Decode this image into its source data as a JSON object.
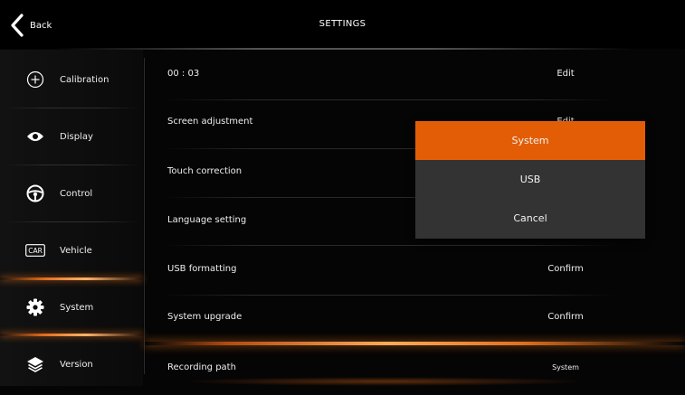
{
  "header": {
    "back_label": "Back",
    "title": "SETTINGS"
  },
  "sidebar": {
    "active_index": 4,
    "items": [
      {
        "label": "Calibration",
        "icon": "circle-plus-icon"
      },
      {
        "label": "Display",
        "icon": "eye-icon"
      },
      {
        "label": "Control",
        "icon": "steering-wheel-icon"
      },
      {
        "label": "Vehicle",
        "icon": "car-badge-icon",
        "badge_text": "CAR"
      },
      {
        "label": "System",
        "icon": "gear-icon"
      },
      {
        "label": "Version",
        "icon": "layers-icon"
      }
    ]
  },
  "settings": {
    "rows": [
      {
        "label": "00 : 03",
        "action": "Edit"
      },
      {
        "label": "Screen adjustment",
        "action": "Edit"
      },
      {
        "label": "Touch correction",
        "action": ""
      },
      {
        "label": "Language setting",
        "action": ""
      },
      {
        "label": "USB formatting",
        "action": "Confirm"
      },
      {
        "label": "System upgrade",
        "action": "Confirm"
      },
      {
        "label": "Recording path",
        "action": "System"
      }
    ]
  },
  "popup": {
    "selected_index": 0,
    "options": [
      "System",
      "USB",
      "Cancel"
    ]
  },
  "colors": {
    "accent": "#e35d06",
    "popup_bg": "#333333",
    "background": "#050505"
  }
}
